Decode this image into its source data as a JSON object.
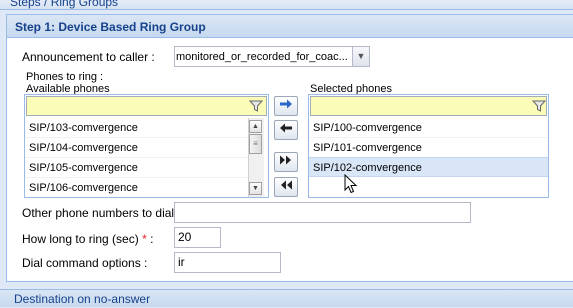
{
  "breadcrumb": "Steps / Ring Groups",
  "step1": {
    "title": "Step 1: Device Based Ring Group",
    "announcement_label": "Announcement to caller :",
    "announcement_value": "monitored_or_recorded_for_coac...",
    "phones_to_ring_label": "Phones to ring :",
    "available_label": "Available phones",
    "selected_label": "Selected phones",
    "available_phones": [
      "SIP/103-comvergence",
      "SIP/104-comvergence",
      "SIP/105-comvergence",
      "SIP/106-comvergence"
    ],
    "selected_phones": [
      "SIP/100-comvergence",
      "SIP/101-comvergence",
      "SIP/102-comvergence"
    ],
    "selected_highlight_index": 2,
    "other_numbers_label": "Other phone numbers to dial :",
    "other_numbers_value": "",
    "ring_time_label": "How long to ring (sec)",
    "required_mark": "*",
    "ring_time_colon": ":",
    "ring_time_value": "20",
    "dial_options_label": "Dial command options :",
    "dial_options_value": "ir"
  },
  "destination_header": "Destination on no-answer",
  "icons": {
    "filter": "funnel-icon",
    "move_right": "arrow-right-icon",
    "move_left": "arrow-left-icon",
    "move_all_right": "double-chevron-right-icon",
    "move_all_left": "double-chevron-left-icon",
    "cursor": "mouse-pointer-icon"
  },
  "colors": {
    "header_text": "#15428b",
    "filter_bg": "#fbfcb8",
    "required": "#e02020",
    "selected_row": "#d9e6f7"
  }
}
